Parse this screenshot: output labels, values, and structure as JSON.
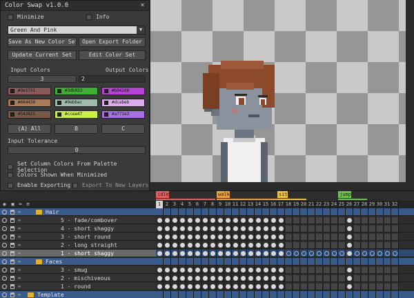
{
  "dialog": {
    "title": "Color Swap v1.0.0",
    "close": "×",
    "minimize_label": "Minimize",
    "info_label": "Info",
    "color_set": "Green And Pink",
    "buttons": {
      "save_new": "Save As New Color Set",
      "open_export": "Open Export Folder",
      "update_current": "Update Current Set",
      "edit_set": "Edit Color Set"
    },
    "input_colors_label": "Input Colors",
    "output_colors_label": "Output Colors",
    "input_colors_value": "3",
    "output_colors_value": "2",
    "swatches": [
      {
        "hex": "#3e2731",
        "color": "#8a5a5a"
      },
      {
        "hex": "#3db033",
        "color": "#3db033"
      },
      {
        "hex": "#b942d6",
        "color": "#b942d6"
      },
      {
        "hex": "#664430",
        "color": "#a97a58"
      },
      {
        "hex": "#9ebbac",
        "color": "#9ebbac"
      },
      {
        "hex": "#dcabeb",
        "color": "#dcabeb"
      },
      {
        "hex": "#543625",
        "color": "#7a5a48"
      },
      {
        "hex": "#ccee47",
        "color": "#ccee47"
      },
      {
        "hex": "#a771e3",
        "color": "#a771e3"
      }
    ],
    "column_buttons": [
      "(A) All",
      "B",
      "C"
    ],
    "input_tolerance_label": "Input Tolerance",
    "input_tolerance_value": "0",
    "options": [
      {
        "label": "Set Column Colors From Palette Selection",
        "checked": false
      },
      {
        "label": "Colors Shown When Minimized",
        "checked": false
      },
      {
        "label": "Enable Exporting",
        "checked": false
      },
      {
        "label": "Export To New Layers",
        "checked": false
      }
    ]
  },
  "timeline": {
    "tags": [
      {
        "label": "idle",
        "color": "#e06060",
        "start": 1,
        "end": 8
      },
      {
        "label": "walk",
        "color": "#e8a040",
        "start": 9,
        "end": 17
      },
      {
        "label": "sit",
        "color": "#f0c040",
        "start": 17,
        "end": 20
      },
      {
        "label": "jump",
        "color": "#70c050",
        "start": 25,
        "end": 28
      }
    ],
    "frame_count": 32,
    "selected_frame": 1,
    "layers": [
      {
        "name": "Hair",
        "type": "group",
        "indent": 1
      },
      {
        "name": "5 - fade/combover",
        "type": "layer",
        "indent": 2,
        "filled": "1-8,9-17,26"
      },
      {
        "name": "4 - short shaggy",
        "type": "layer",
        "indent": 2,
        "filled": "1-8,9-17,26"
      },
      {
        "name": "3 - short round",
        "type": "layer",
        "indent": 2,
        "filled": "1-8,9-17,26"
      },
      {
        "name": "2 - long straight",
        "type": "layer",
        "indent": 2,
        "filled": "1-8,9-17,26"
      },
      {
        "name": "1 - short shaggy",
        "type": "layer",
        "indent": 2,
        "active": true,
        "filled": "1-8,9-17,26"
      },
      {
        "name": "Faces",
        "type": "group",
        "indent": 1
      },
      {
        "name": "3 - smug",
        "type": "layer",
        "indent": 2,
        "filled": "1-8,9-17,26"
      },
      {
        "name": "2 - mischiveous",
        "type": "layer",
        "indent": 2,
        "filled": "1-8,9-17,26"
      },
      {
        "name": "1 - round",
        "type": "layer",
        "indent": 2,
        "filled": "1-8,9-17,26"
      },
      {
        "name": "Template",
        "type": "group",
        "indent": 0
      }
    ]
  }
}
